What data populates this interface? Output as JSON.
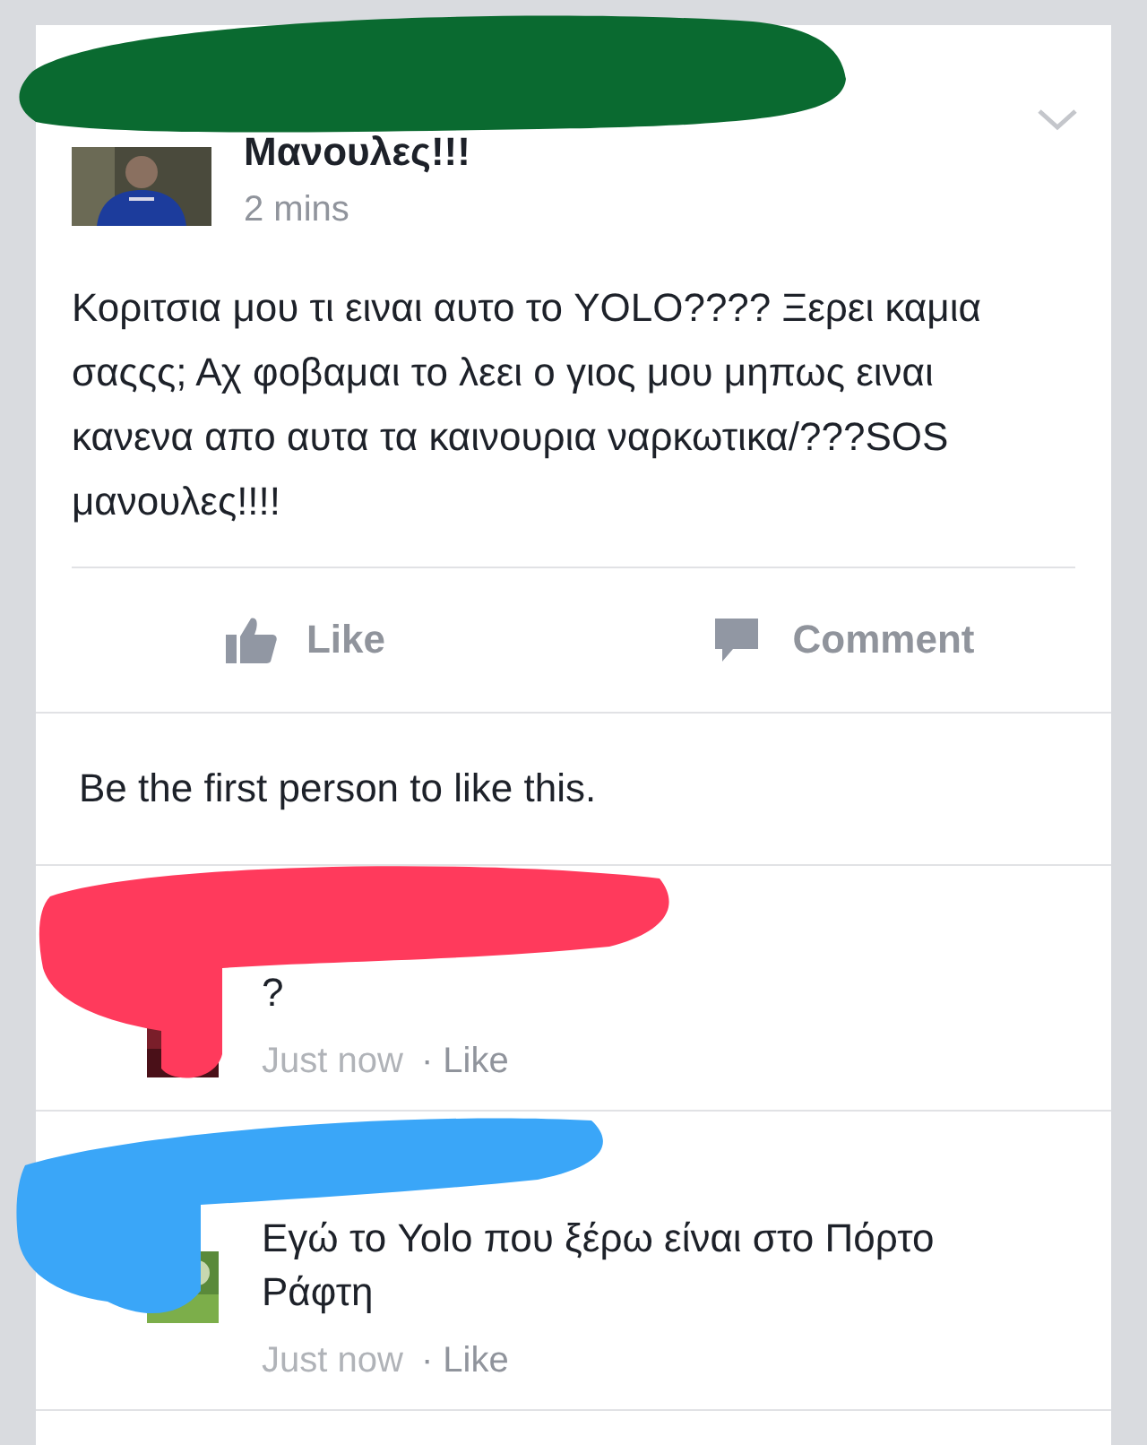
{
  "post": {
    "author": "Μανουλες!!!",
    "time": "2 mins",
    "text": "Κοριτσια μου τι ειναι αυτο το YOLO???? Ξερει καμια σαςςς; Αχ φοβαμαι το λεει ο γιος μου μηπως ειναι κανενα απο αυτα τα καινουρια ναρκωτικα/???SOS μανουλες!!!!",
    "actions": [
      "Like",
      "Comment"
    ],
    "likes_summary": "Be the first person to like this."
  },
  "comments": [
    {
      "text": "?",
      "time": "Just now",
      "action": "· Like"
    },
    {
      "text": "Εγώ το Yolo που ξέρω είναι στο Πόρτο Ράφτη",
      "time": "Just now",
      "action": "· Like"
    }
  ],
  "scribbles": [
    {
      "color": "#0a6a30"
    },
    {
      "color": "#ff3a5c"
    },
    {
      "color": "#3aa6f8"
    }
  ]
}
